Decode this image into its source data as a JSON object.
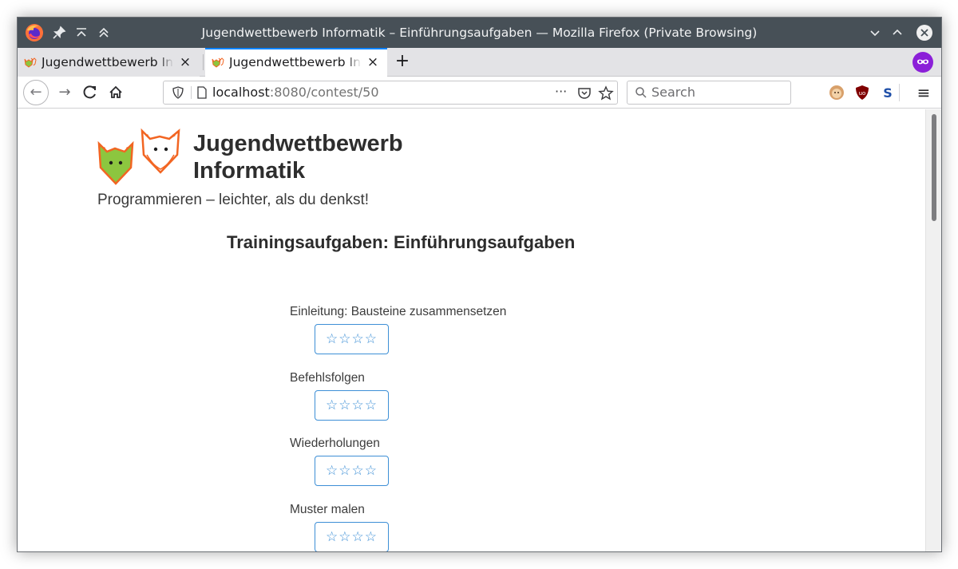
{
  "window": {
    "title": "Jugendwettbewerb Informatik – Einführungsaufgaben — Mozilla Firefox (Private Browsing)",
    "title_icons": [
      "pin-icon",
      "keep-above-icon",
      "keep-above-alt-icon"
    ],
    "controls": [
      "minimize-icon",
      "maximize-icon",
      "close-icon"
    ]
  },
  "tabs": [
    {
      "label": "Jugendwettbewerb Informatik",
      "active": false,
      "close": "×"
    },
    {
      "label": "Jugendwettbewerb Informatik",
      "active": true,
      "close": "×"
    }
  ],
  "tabstrip": {
    "new_tab": "+"
  },
  "nav": {
    "back": "←",
    "forward": "→",
    "reload": "C",
    "home": "⌂",
    "url_host": "localhost",
    "url_path": ":8080/contest/50",
    "page_actions": "···",
    "search_placeholder": "Search",
    "menu": "≡",
    "extensions": [
      "monkey-icon",
      "ublock-icon",
      "s-extension-icon"
    ]
  },
  "page": {
    "site_title": "Jugendwettbewerb Informatik",
    "tagline": "Programmieren – leichter, als du denkst!",
    "heading": "Trainingsaufgaben: Einführungsaufgaben",
    "tasks": [
      {
        "title": "Einleitung: Bausteine zusammensetzen",
        "stars": "☆☆☆☆"
      },
      {
        "title": "Befehlsfolgen",
        "stars": "☆☆☆☆"
      },
      {
        "title": "Wiederholungen",
        "stars": "☆☆☆☆"
      },
      {
        "title": "Muster malen",
        "stars": "☆☆☆☆"
      }
    ]
  },
  "colors": {
    "titlebar": "#475057",
    "tab_accent": "#0a84ff",
    "star_button": "#3d8fd6",
    "fox_green": "#8cc63f",
    "fox_orange": "#f26522",
    "private_purple": "#8b1fd8"
  }
}
